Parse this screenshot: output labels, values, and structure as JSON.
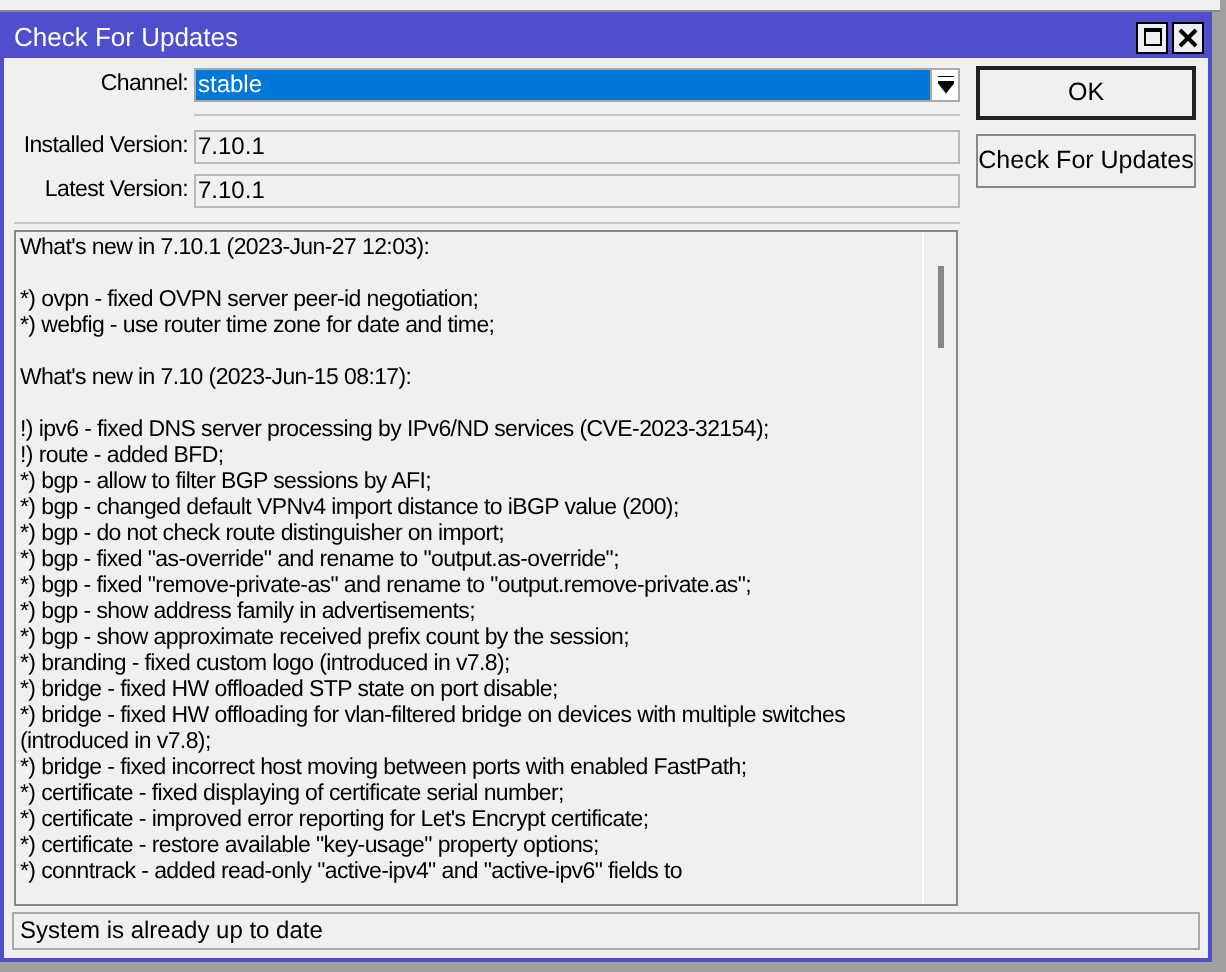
{
  "window": {
    "title": "Check For Updates"
  },
  "channel": {
    "label": "Channel:",
    "value": "stable",
    "highlighted": true
  },
  "fields": [
    {
      "label": "Installed Version:",
      "value": "7.10.1"
    },
    {
      "label": "Latest Version:",
      "value": "7.10.1"
    }
  ],
  "buttons": [
    {
      "label": "OK",
      "default": true
    },
    {
      "label": "Check For Updates",
      "default": false
    }
  ],
  "changelog": [
    [
      "What's new in 7.10.1 (2023-Jun-27 12:03):"
    ],
    [
      "*) ovpn - fixed OVPN server peer-id negotiation;",
      "*) webfig - use router time zone for date and time;"
    ],
    [
      "What's new in 7.10 (2023-Jun-15 08:17):"
    ],
    [
      "!) ipv6 - fixed DNS server processing by IPv6/ND services (CVE-2023-32154);",
      "!) route - added BFD;",
      "*) bgp - allow to filter BGP sessions by AFI;",
      "*) bgp - changed default VPNv4 import distance to iBGP value (200);",
      "*) bgp - do not check route distinguisher on import;",
      "*) bgp - fixed \"as-override\" and rename to \"output.as-override\";",
      "*) bgp - fixed \"remove-private-as\" and rename to \"output.remove-private.as\";",
      "*) bgp - show address family in advertisements;",
      "*) bgp - show approximate received prefix count by the session;",
      "*) branding - fixed custom logo (introduced in v7.8);",
      "*) bridge - fixed HW offloaded STP state on port disable;",
      "*) bridge - fixed HW offloading for vlan-filtered bridge on devices with multiple switches",
      "(introduced in v7.8);",
      "*) bridge - fixed incorrect host moving between ports with enabled FastPath;",
      "*) certificate - fixed displaying of certificate serial number;",
      "*) certificate - improved error reporting for Let's Encrypt certificate;",
      "*) certificate - restore available \"key-usage\" property options;",
      "*) conntrack - added read-only \"active-ipv4\" and \"active-ipv6\" fields to"
    ]
  ],
  "status_bar": "System is already up to date"
}
